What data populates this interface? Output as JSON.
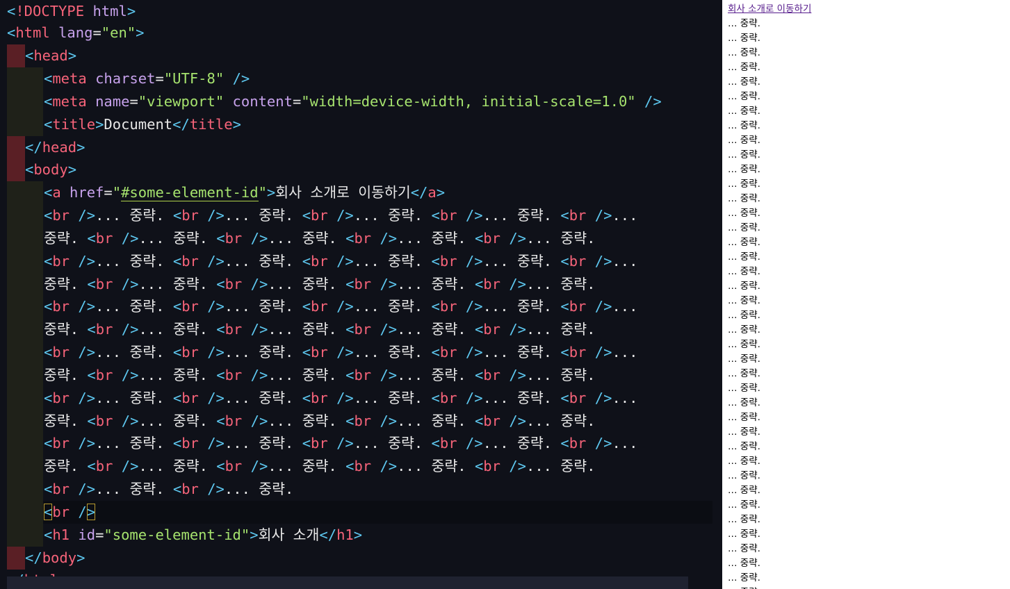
{
  "editor": {
    "line_1": {
      "lt": "<",
      "tag": "!DOCTYPE",
      "attr": "html",
      "gt": ">"
    },
    "line_2": {
      "lt": "<",
      "tag": "html",
      "attr": "lang",
      "eq": "=",
      "val": "\"en\"",
      "gt": ">"
    },
    "line_3": {
      "lt": "<",
      "tag": "head",
      "gt": ">"
    },
    "line_4": {
      "lt": "<",
      "tag": "meta",
      "attr": "charset",
      "eq": "=",
      "val": "\"UTF-8\"",
      "end": "/>"
    },
    "line_5": {
      "lt": "<",
      "tag": "meta",
      "attr1": "name",
      "eq1": "=",
      "val1": "\"viewport\"",
      "attr2": "content",
      "eq2": "=",
      "val2": "\"width=device-width, initial-scale=1.0\"",
      "end": "/>"
    },
    "line_6": {
      "lt": "<",
      "tag": "title",
      "gt": ">",
      "text": "Document",
      "lt2": "</",
      "tag2": "title",
      "gt2": ">"
    },
    "line_7": {
      "lt": "</",
      "tag": "head",
      "gt": ">"
    },
    "line_8": {
      "lt": "<",
      "tag": "body",
      "gt": ">"
    },
    "line_9": {
      "lt": "<",
      "tag": "a",
      "attr": "href",
      "eq": "=",
      "q1": "\"",
      "val": "#some-element-id",
      "q2": "\"",
      "gt": ">",
      "text": "회사 소개로 이동하기",
      "lt2": "</",
      "tag2": "a",
      "gt2": ">"
    },
    "br_lt": "<",
    "br_tag": "br",
    "br_end": "/>",
    "ellipsis": "...",
    "omitted": "중략.",
    "line_22": {
      "lt": "<",
      "tag": "br",
      "end1": "/",
      "end2": ">"
    },
    "line_23": {
      "lt": "<",
      "tag": "h1",
      "attr": "id",
      "eq": "=",
      "val": "\"some-element-id\"",
      "gt": ">",
      "text": "회사 소개",
      "lt2": "</",
      "tag2": "h1",
      "gt2": ">"
    },
    "line_24": {
      "lt": "</",
      "tag": "body",
      "gt": ">"
    },
    "line_25": {
      "lt": "</",
      "tag": "html",
      "gt": ">"
    }
  },
  "preview": {
    "link_text": "회사 소개로 이동하기",
    "omitted_text": "… 중략."
  }
}
